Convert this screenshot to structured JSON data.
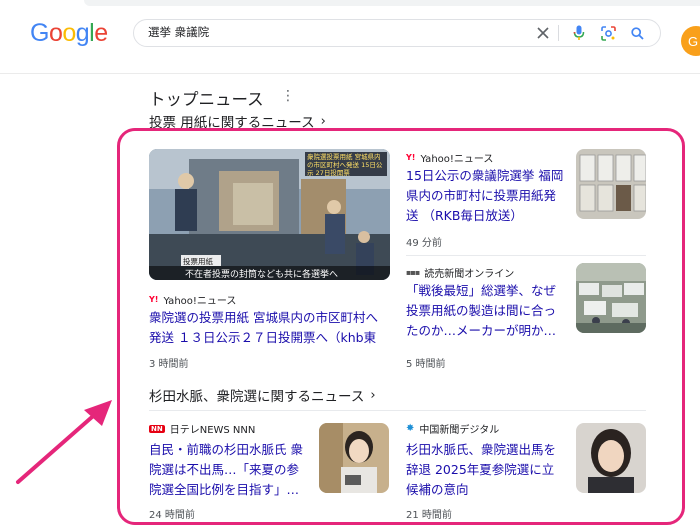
{
  "header": {
    "logo_letters": [
      {
        "ch": "G",
        "color": "#4285F4"
      },
      {
        "ch": "o",
        "color": "#EA4335"
      },
      {
        "ch": "o",
        "color": "#FBBC05"
      },
      {
        "ch": "g",
        "color": "#4285F4"
      },
      {
        "ch": "l",
        "color": "#34A853"
      },
      {
        "ch": "e",
        "color": "#EA4335"
      }
    ],
    "search_value": "選挙 衆議院",
    "avatar_letter": "G"
  },
  "section": {
    "title": "トップニュース"
  },
  "groups": [
    {
      "heading": "投票 用紙に関するニュース",
      "cards": [
        {
          "source": "Yahoo!ニュース",
          "source_icon": "yahoo-logo",
          "headline": "衆院選の投票用紙 宮城県内の市区町村へ発送 １３日公示２７日投開票へ（khb東日…",
          "time": "3 時間前",
          "image_overlay_top": "衆院選投票用紙 宮城県内の市区町村へ発送 15日公示 27日投開票",
          "image_overlay_label": "投票用紙",
          "image_caption": "不在者投票の封筒なども共に各選挙へ"
        },
        {
          "source": "Yahoo!ニュース",
          "source_icon": "yahoo-logo",
          "headline": "15日公示の衆議院選挙 福岡県内の市町村に投票用紙発送 （RKB毎日放送）",
          "time": "49 分前"
        },
        {
          "source": "読売新聞オンライン",
          "source_icon": "yomiuri-logo",
          "headline": "「戦後最短」総選挙、なぜ投票用紙の製造は間に合ったのか…メーカーが明か…",
          "time": "5 時間前"
        }
      ]
    },
    {
      "heading": "杉田水脈、衆院選に関するニュース",
      "cards": [
        {
          "source": "日テレNEWS NNN",
          "source_icon": "ntv-logo",
          "headline": "自民・前職の杉田水脈氏 衆院選は不出馬…「来夏の参院選全国比例を目指す」…",
          "time": "24 時間前"
        },
        {
          "source": "中国新聞デジタル",
          "source_icon": "chugoku-logo",
          "headline": "杉田水脈氏、衆院選出馬を辞退 2025年夏参院選に立候補の意向",
          "time": "21 時間前"
        }
      ]
    }
  ],
  "colors": {
    "link": "#1a0dab",
    "highlight": "#e5267a",
    "arrow": "#e5267a"
  }
}
